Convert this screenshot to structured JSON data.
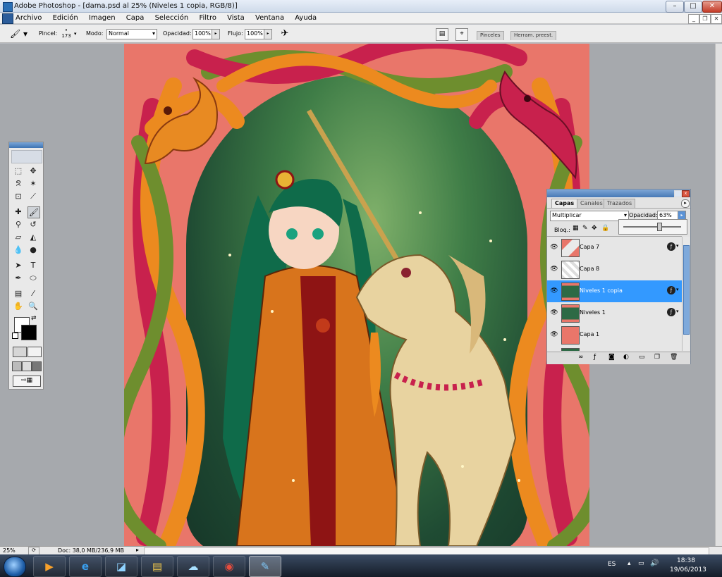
{
  "window": {
    "title": "Adobe Photoshop - [dama.psd al 25% (Niveles 1 copia, RGB/8)]"
  },
  "window_controls": {
    "minimize": "–",
    "maximize": "□",
    "close": "✕",
    "doc_minimize": "_",
    "doc_restore": "❐",
    "doc_close": "✕"
  },
  "menu": [
    "Archivo",
    "Edición",
    "Imagen",
    "Capa",
    "Selección",
    "Filtro",
    "Vista",
    "Ventana",
    "Ayuda"
  ],
  "options": {
    "brush_label": "Pincel:",
    "brush_size": "173",
    "mode_label": "Modo:",
    "mode_value": "Normal",
    "opacity_label": "Opacidad:",
    "opacity_value": "100%",
    "flow_label": "Flujo:",
    "flow_value": "100%",
    "well_tabs": [
      "Pinceles",
      "Herram. preest."
    ]
  },
  "toolbox": {
    "tools": [
      "marquee-tool-icon",
      "move-tool-icon",
      "lasso-tool-icon",
      "magic-wand-tool-icon",
      "crop-tool-icon",
      "slice-tool-icon",
      "healing-brush-tool-icon",
      "brush-tool-icon",
      "clone-stamp-tool-icon",
      "history-brush-tool-icon",
      "eraser-tool-icon",
      "paint-bucket-tool-icon",
      "blur-tool-icon",
      "dodge-tool-icon",
      "path-selection-tool-icon",
      "type-tool-icon",
      "pen-tool-icon",
      "shape-tool-icon",
      "notes-tool-icon",
      "eyedropper-tool-icon",
      "hand-tool-icon",
      "zoom-tool-icon"
    ],
    "type_glyph": "T"
  },
  "layers_panel": {
    "tabs": [
      "Capas",
      "Canales",
      "Trazados"
    ],
    "blend_mode": "Multiplicar",
    "opacity_label": "Opacidad:",
    "opacity_value": "63%",
    "lock_label": "Bloq.:",
    "layers": [
      {
        "name": "Capa 7",
        "active": false,
        "fx": true,
        "thumb": "art"
      },
      {
        "name": "Capa 8",
        "active": false,
        "fx": false,
        "thumb": "transparent"
      },
      {
        "name": "Niveles 1 copia",
        "active": true,
        "fx": true,
        "thumb": "art"
      },
      {
        "name": "Niveles 1",
        "active": false,
        "fx": true,
        "thumb": "art"
      },
      {
        "name": "Capa 1",
        "active": false,
        "fx": false,
        "thumb": "red"
      }
    ]
  },
  "status": {
    "zoom": "25%",
    "doc": "Doc: 38,0 MB/236,9 MB"
  },
  "taskbar": {
    "apps": [
      "media-player-icon",
      "internet-explorer-icon",
      "window-app-icon",
      "file-explorer-icon",
      "cloud-app-icon",
      "chrome-icon",
      "paint-app-icon"
    ],
    "lang": "ES",
    "time": "18:38",
    "date": "19/06/2013"
  },
  "colors": {
    "canvas_bg": "#e9766a",
    "knot_red": "#c8214d",
    "knot_orange": "#ec8a1f",
    "knot_green": "#6e8e2e",
    "selection_blue": "#3399ff"
  }
}
